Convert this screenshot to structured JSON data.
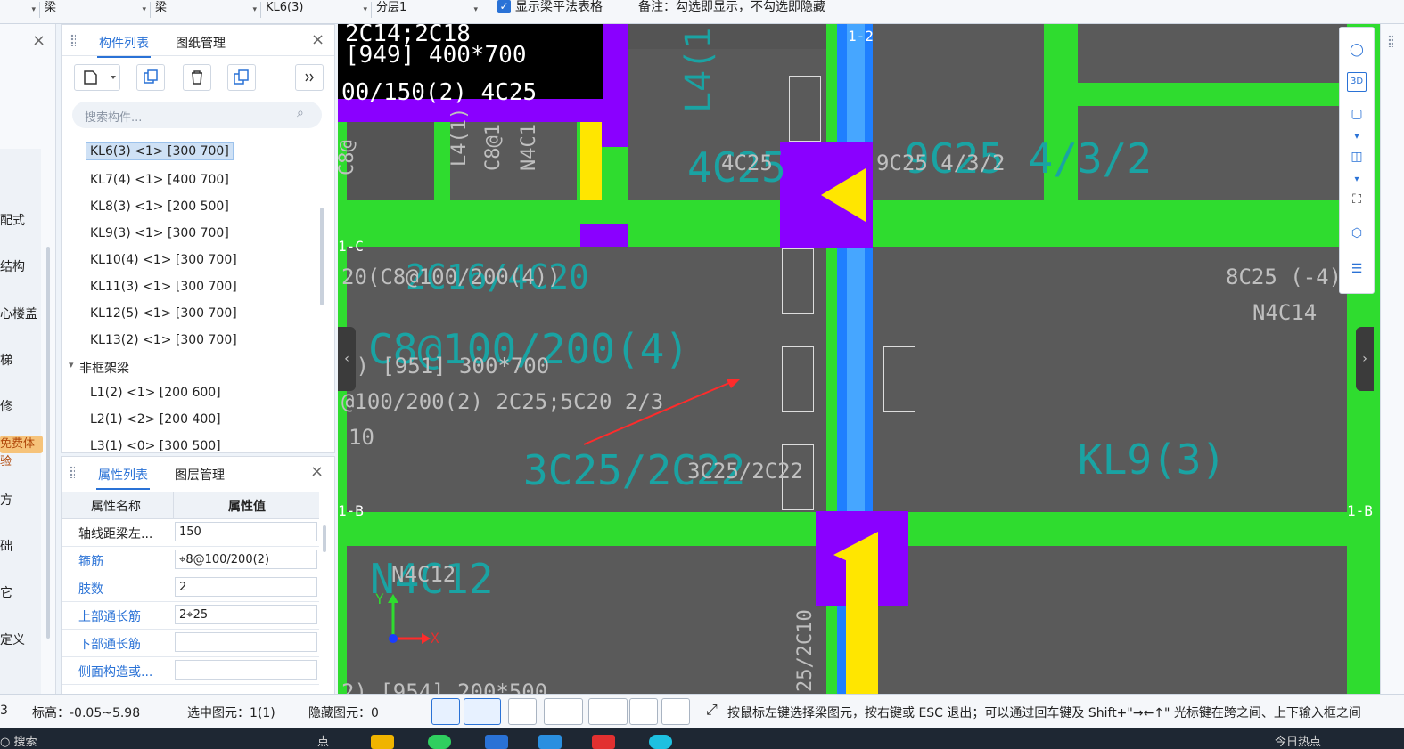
{
  "toolbar": {
    "dropdowns": [
      "",
      "梁",
      "梁",
      "KL6(3)",
      "分层1"
    ],
    "show_table_checkbox": "显示梁平法表格",
    "note": "备注：勾选即显示，不勾选即隐藏"
  },
  "left_strip": {
    "items": [
      "配式",
      "结构",
      "心楼盖",
      "梯",
      "修",
      "方",
      "础",
      "它",
      "定义"
    ],
    "promo_badge": "免费体验"
  },
  "component_panel": {
    "tabs": [
      "构件列表",
      "图纸管理"
    ],
    "search_placeholder": "搜索构件...",
    "items": [
      "KL6(3) <1> [300 700]",
      "KL7(4) <1> [400 700]",
      "KL8(3) <1> [200 500]",
      "KL9(3) <1> [300 700]",
      "KL10(4) <1> [300 700]",
      "KL11(3) <1> [300 700]",
      "KL12(5) <1> [300 700]",
      "KL13(2) <1> [300 700]"
    ],
    "group_label": "非框架梁",
    "group_items": [
      "L1(2) <1> [200 600]",
      "L2(1) <2> [200 400]",
      "L3(1) <0> [300 500]"
    ]
  },
  "property_panel": {
    "tabs": [
      "属性列表",
      "图层管理"
    ],
    "col_name": "属性名称",
    "col_value": "属性值",
    "rows": [
      {
        "name": "轴线距梁左...",
        "value": "150"
      },
      {
        "name": "箍筋",
        "value": "⌖8@100/200(2)"
      },
      {
        "name": "肢数",
        "value": "2"
      },
      {
        "name": "上部通长筋",
        "value": "2⌖25"
      },
      {
        "name": "下部通长筋",
        "value": ""
      },
      {
        "name": "侧面构造或...",
        "value": ""
      }
    ]
  },
  "canvas": {
    "labels": {
      "top1": "2C14;2C18",
      "top2": "[949] 400*700",
      "top3": "00/150(2) 4C25",
      "axis_12": "1-2",
      "axis_1c": "1-C",
      "axis_1b": "1-B",
      "axis_1b_right": "1-B",
      "l4": "L4(1)",
      "c8left": "C8@",
      "l4b": "L4(1)",
      "c8mid": "C8@1",
      "n4c1": "N4C1",
      "c25_4": "4C25",
      "c25_4_big": "4C25",
      "c25_9": "9C25 4/3/2",
      "c25_9_big": "9C25 4/3/2",
      "r_8c25": "8C25 (-4)/",
      "r_n4c14": "N4C14",
      "l_20c8": "20(C8@100/200(4))",
      "l_2c16": "2C16/4C20",
      "l_c8big": "C8@100/200(4)",
      "l_951": "3) [951] 300*700",
      "l_100": "@100/200(2) 2C25;5C20 2/3",
      "l_10": "10",
      "l_3c25big": "3C25/2C22",
      "l_3c25": "3C25/2C22",
      "kl9": "KL9(3)",
      "n4c12": "N4C12",
      "n4c12big": "N4C12",
      "v_2c10": "25/2C10",
      "l_954": "2) [954] 200*500",
      "axis_x": "X",
      "axis_y": "Y"
    }
  },
  "statusbar": {
    "elevation": "标高：-0.05~5.98",
    "selected": "选中图元：1(1)",
    "hidden": "隐藏图元：0",
    "hint": "按鼠标左键选择梁图元，按右键或 ESC 退出；可以通过回车键及 Shift+\"→←↑\" 光标键在跨之间、上下输入框之间",
    "left_num": "3"
  },
  "taskbar": {
    "search": "搜索",
    "item_text": "点",
    "right_text": "今日热点"
  },
  "colors": {
    "beam_green": "#2fdc2f",
    "column_purple": "#8a00ff",
    "selected_blue": "#1f7fff",
    "accent": "#2a72d6"
  }
}
